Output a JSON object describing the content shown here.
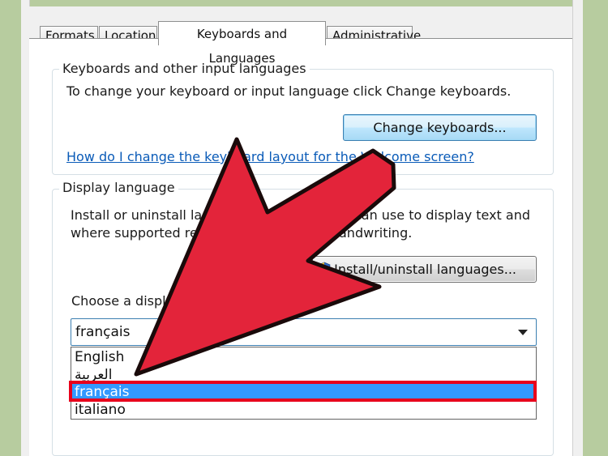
{
  "tabs": [
    "Formats",
    "Location",
    "Keyboards and Languages",
    "Administrative"
  ],
  "keyboards_group": {
    "title": "Keyboards and other input languages",
    "description": "To change your keyboard or input language click Change keyboards.",
    "change_button": "Change keyboards...",
    "help_link": "How do I change the keyboard layout for the Welcome screen?"
  },
  "display_group": {
    "title": "Display language",
    "description_line1": "Install or uninstall languages that Windows can use to display text and",
    "description_line2": "where supported recognize speech and handwriting.",
    "install_button": "Install/uninstall languages...",
    "choose_label": "Choose a display language:",
    "selected_value": "français",
    "options": [
      "English",
      "العربية",
      "français",
      "italiano"
    ]
  },
  "colors": {
    "background": "#b7cc9f",
    "arrow": "#e3243a",
    "selection": "#3399ff",
    "highlight_border": "#e8001c"
  }
}
